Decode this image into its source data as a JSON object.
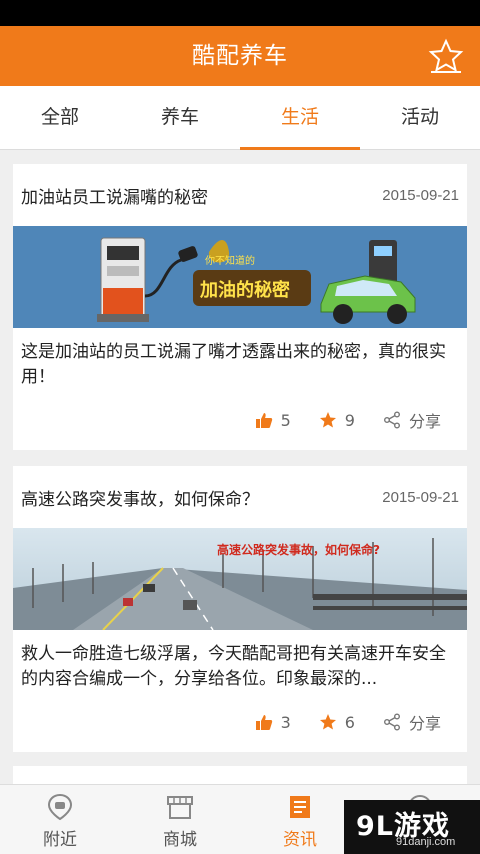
{
  "header": {
    "title": "酷配养车"
  },
  "tabs": [
    {
      "label": "全部"
    },
    {
      "label": "养车"
    },
    {
      "label": "生活"
    },
    {
      "label": "活动"
    }
  ],
  "active_tab": "生活",
  "articles": [
    {
      "title": "加油站员工说漏嘴的秘密",
      "date": "2015-09-21",
      "banner_small": "你不知道的",
      "banner_big": "加油的秘密",
      "summary": "这是加油站的员工说漏了嘴才透露出来的秘密，真的很实用！",
      "likes": "5",
      "favorites": "9",
      "share": "分享"
    },
    {
      "title": "高速公路突发事故，如何保命？",
      "date": "2015-09-21",
      "banner_text": "高速公路突发事故，如何保命?",
      "summary": "救人一命胜造七级浮屠，今天酷配哥把有关高速开车安全的内容合编成一个，分享给各位。印象最深的...",
      "likes": "3",
      "favorites": "6",
      "share": "分享"
    }
  ],
  "bottom_nav": [
    {
      "label": "附近",
      "icon": "location-pin-icon"
    },
    {
      "label": "商城",
      "icon": "store-icon"
    },
    {
      "label": "资讯",
      "icon": "news-icon"
    }
  ],
  "watermark": {
    "main": "9L游戏",
    "sub": "91danji.com"
  },
  "colors": {
    "accent": "#f07a1a",
    "status_bar": "#000000",
    "background": "#efefef"
  }
}
